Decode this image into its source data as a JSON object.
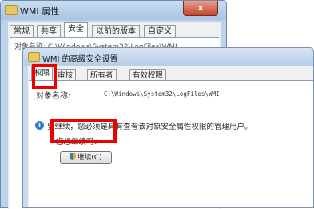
{
  "background_window": {
    "title": "WMI 属性",
    "close_glyph": "x",
    "tabs": [
      "常规",
      "共享",
      "安全",
      "以前的版本",
      "自定义"
    ],
    "object_name_partial": "对象名称:  C:\\Windows\\System32\\LogFiles\\WMI"
  },
  "dialog": {
    "title": "WMI 的高级安全设置",
    "tabs": [
      "权限",
      "审核",
      "所有者",
      "有效权限"
    ],
    "selected_tab": "权限",
    "object_name_label": "对象名称:",
    "object_name_value": "C:\\Windows\\System32\\LogFiles\\WMI",
    "info_message": "要继续，您必须是具有查看该对象安全属性权限的管理用户。",
    "question": "您想继续吗?",
    "continue_button": "继续(C)",
    "info_icon_glyph": "i",
    "icons": [
      "folder-icon",
      "info-icon",
      "shield-icon"
    ]
  },
  "highlight_color": "#ee0000"
}
